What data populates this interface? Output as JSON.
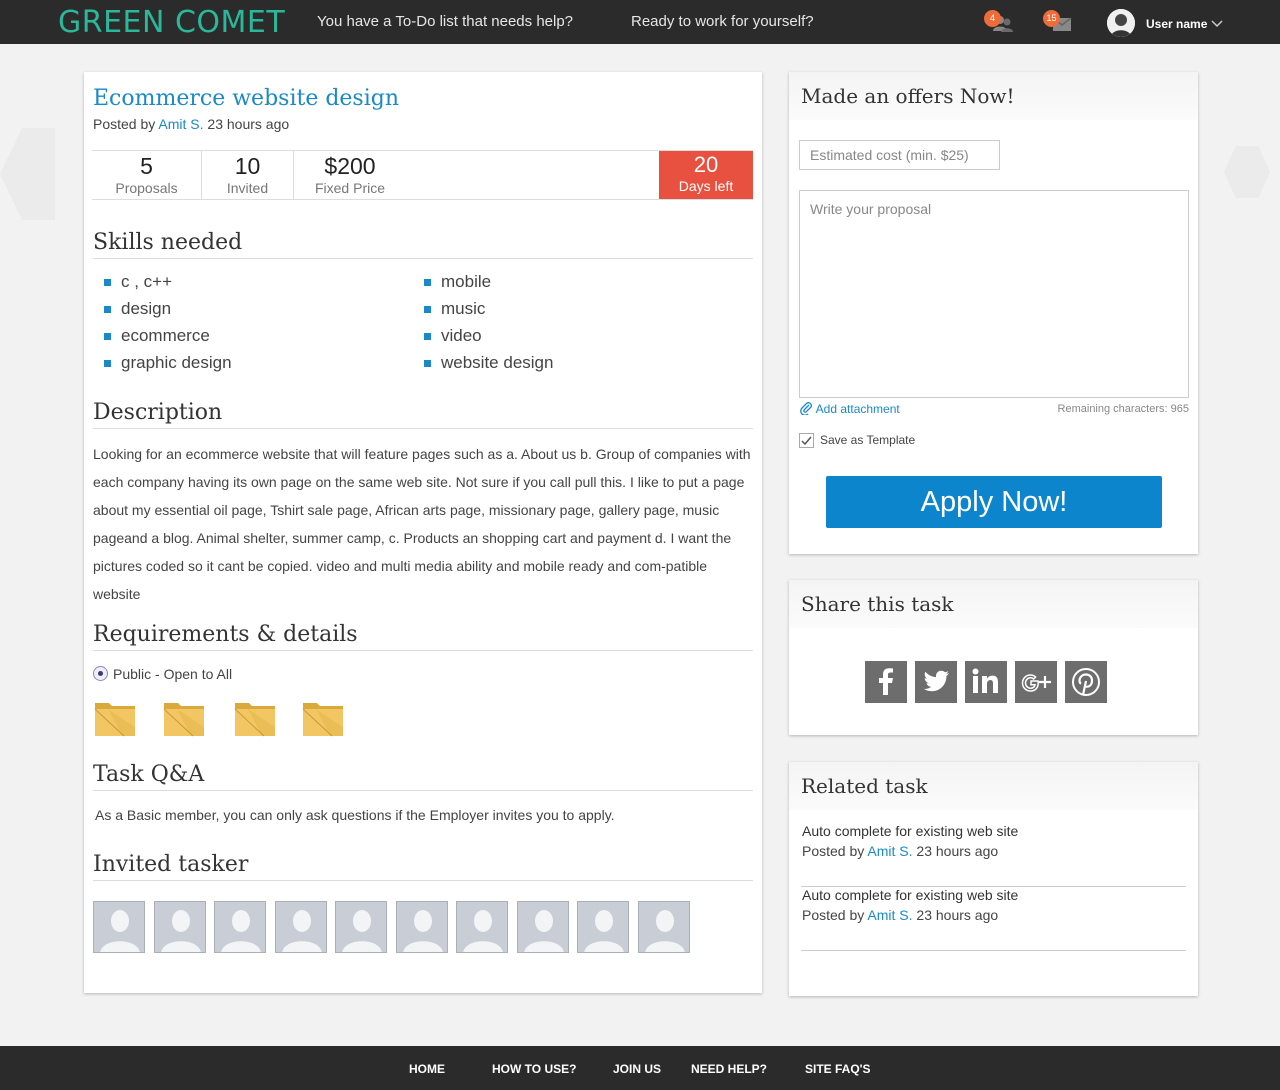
{
  "header": {
    "logo": "GREEN COMET",
    "links": [
      "You have a To-Do list that needs help?",
      "Ready to work for yourself?"
    ],
    "notifications": {
      "people_count": "4",
      "messages_count": "15"
    },
    "username": "User name"
  },
  "task": {
    "title": "Ecommerce website design",
    "posted_prefix": "Posted by",
    "author": "Amit S.",
    "time": "23 hours ago",
    "stats": [
      {
        "value": "5",
        "label": "Proposals"
      },
      {
        "value": "10",
        "label": "Invited"
      },
      {
        "value": "$200",
        "label": "Fixed Price"
      }
    ],
    "days_left": {
      "value": "20",
      "label": "Days left"
    }
  },
  "skills": {
    "heading": "Skills needed",
    "items": [
      "c , c++",
      "design",
      "ecommerce",
      "graphic design",
      "mobile",
      "music",
      "video",
      "website design"
    ]
  },
  "description": {
    "heading": "Description",
    "text": "Looking for an ecommerce website that will feature pages such as a. About us b. Group of companies with each company having its own page on the same web site. Not sure if you call pull this. I like to put a page about my essential oil page, Tshirt sale page, African arts page, missionary page, gallery page, music pageand a blog. Animal shelter, summer camp, c. Products an shopping cart and payment d. I want the pictures coded so it cant be copied. video and multi media ability and mobile ready and com-patible website"
  },
  "requirements": {
    "heading": "Requirements & details",
    "visibility": "Public - Open to All",
    "attachments_count": 4
  },
  "qa": {
    "heading": "Task Q&A",
    "text": "As a Basic member, you can only ask questions if the Employer invites you to apply."
  },
  "invited": {
    "heading": "Invited tasker",
    "count": 10
  },
  "offer": {
    "heading": "Made an offers Now!",
    "cost_placeholder": "Estimated cost (min. $25)",
    "proposal_placeholder": "Write your proposal",
    "attach_label": "Add attachment",
    "remaining": "Remaining characters: 965",
    "save_template": "Save as Template",
    "save_template_checked": true,
    "apply_label": "Apply Now!"
  },
  "share": {
    "heading": "Share this task",
    "networks": [
      "facebook-icon",
      "twitter-icon",
      "linkedin-icon",
      "google-plus-icon",
      "pinterest-icon"
    ]
  },
  "related": {
    "heading": "Related task",
    "items": [
      {
        "title": "Auto complete for existing web site",
        "posted_prefix": "Posted by",
        "author": "Amit S.",
        "time": "23 hours ago"
      },
      {
        "title": "Auto complete for existing web site",
        "posted_prefix": "Posted by",
        "author": "Amit S.",
        "time": "23 hours ago"
      }
    ]
  },
  "footer": {
    "links": [
      "HOME",
      "HOW TO USE?",
      "JOIN US",
      "NEED HELP?",
      "SITE FAQ'S"
    ]
  },
  "colors": {
    "brand": "#2bb89a",
    "accent": "#1a8ac6",
    "days_left": "#e8503f",
    "apply": "#0d85cc",
    "badge": "#ef6c3a"
  }
}
